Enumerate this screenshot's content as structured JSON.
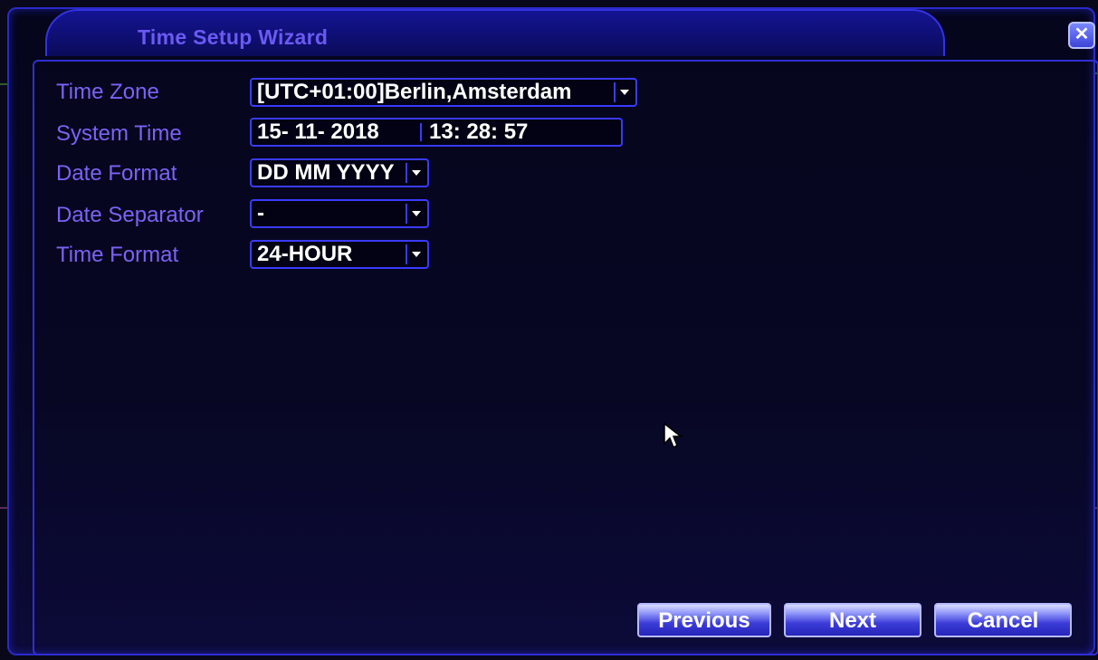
{
  "window": {
    "title": "Time Setup Wizard",
    "close_icon": "close-icon"
  },
  "form": {
    "time_zone": {
      "label": "Time Zone",
      "value": "[UTC+01:00]Berlin,Amsterdam"
    },
    "system_time": {
      "label": "System Time",
      "date": "15- 11- 2018",
      "time": "13: 28: 57"
    },
    "date_format": {
      "label": "Date Format",
      "value": "DD MM YYYY"
    },
    "date_separator": {
      "label": "Date Separator",
      "value": "-"
    },
    "time_format": {
      "label": "Time Format",
      "value": "24-HOUR"
    }
  },
  "buttons": {
    "previous": "Previous",
    "next": "Next",
    "cancel": "Cancel"
  },
  "colors": {
    "accent": "#2a2ac8",
    "label": "#7a63f5",
    "value": "#ffffff"
  }
}
